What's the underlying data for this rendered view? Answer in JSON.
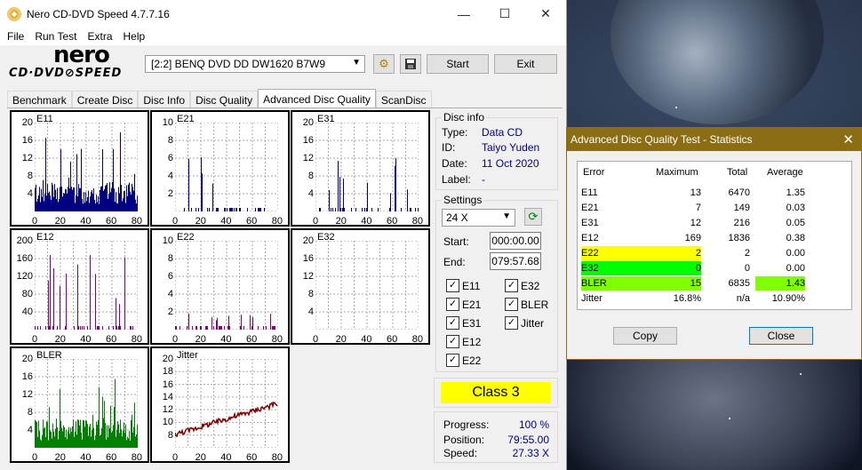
{
  "window": {
    "title": "Nero CD-DVD Speed 4.7.7.16",
    "minimize": "—",
    "maximize": "☐",
    "close": "✕"
  },
  "menu": [
    "File",
    "Run Test",
    "Extra",
    "Help"
  ],
  "logo": {
    "top": "nero",
    "bottom": "CD·DVD⊘SPEED"
  },
  "toolbar": {
    "drive": "[2:2]   BENQ DVD DD DW1620 B7W9",
    "start": "Start",
    "exit": "Exit"
  },
  "tabs": [
    "Benchmark",
    "Create Disc",
    "Disc Info",
    "Disc Quality",
    "Advanced Disc Quality",
    "ScanDisc"
  ],
  "graphs": [
    {
      "name": "E11",
      "yticks": [
        "20",
        "16",
        "12",
        "8",
        "4"
      ],
      "xticks": [
        "0",
        "20",
        "40",
        "60",
        "80"
      ],
      "color": "#000080",
      "peak_percent": 85
    },
    {
      "name": "E21",
      "yticks": [
        "10",
        "8",
        "6",
        "4",
        "2"
      ],
      "xticks": [
        "0",
        "20",
        "40",
        "60",
        "80"
      ],
      "color": "#000080",
      "peak_percent": 70
    },
    {
      "name": "E31",
      "yticks": [
        "20",
        "16",
        "12",
        "8",
        "4"
      ],
      "xticks": [
        "0",
        "20",
        "40",
        "60",
        "80"
      ],
      "color": "#000080",
      "peak_percent": 60
    },
    {
      "name": "E12",
      "yticks": [
        "200",
        "160",
        "120",
        "80",
        "40"
      ],
      "xticks": [
        "0",
        "20",
        "40",
        "60",
        "80"
      ],
      "color": "#800080",
      "peak_percent": 85
    },
    {
      "name": "E22",
      "yticks": [
        "10",
        "8",
        "6",
        "4",
        "2"
      ],
      "xticks": [
        "0",
        "20",
        "40",
        "60",
        "80"
      ],
      "color": "#800080",
      "peak_percent": 20
    },
    {
      "name": "E32",
      "yticks": [
        "20",
        "16",
        "12",
        "8",
        "4"
      ],
      "xticks": [
        "0",
        "20",
        "40",
        "60",
        "80"
      ],
      "color": "#800080",
      "peak_percent": 0
    },
    {
      "name": "BLER",
      "yticks": [
        "20",
        "16",
        "12",
        "8",
        "4"
      ],
      "xticks": [
        "0",
        "20",
        "40",
        "60",
        "80"
      ],
      "color": "#008000",
      "peak_percent": 75
    },
    {
      "name": "Jitter",
      "yticks": [
        "20",
        "18",
        "16",
        "14",
        "12",
        "10",
        "8"
      ],
      "xticks": [
        "0",
        "20",
        "40",
        "60",
        "80"
      ],
      "color": "#800000",
      "peak_percent": 60
    }
  ],
  "disc_info": {
    "title": "Disc info",
    "type_label": "Type:",
    "type": "Data CD",
    "id_label": "ID:",
    "id": "Taiyo Yuden",
    "date_label": "Date:",
    "date": "11 Oct 2020",
    "label_label": "Label:",
    "label": "-"
  },
  "settings": {
    "title": "Settings",
    "speed": "24 X",
    "start_label": "Start:",
    "start": "000:00.00",
    "end_label": "End:",
    "end": "079:57.68",
    "checks_left": [
      "E11",
      "E21",
      "E31",
      "E12",
      "E22"
    ],
    "checks_right": [
      "E32",
      "BLER",
      "Jitter"
    ]
  },
  "class": "Class 3",
  "progress": {
    "progress_label": "Progress:",
    "progress": "100 %",
    "position_label": "Position:",
    "position": "79:55.00",
    "speed_label": "Speed:",
    "speed": "27.33 X"
  },
  "dialog": {
    "title": "Advanced Disc Quality Test - Statistics",
    "headers": [
      "Error",
      "Maximum",
      "Total",
      "Average"
    ],
    "rows": [
      [
        "E11",
        "13",
        "6470",
        "1.35"
      ],
      [
        "E21",
        "7",
        "149",
        "0.03"
      ],
      [
        "E31",
        "12",
        "216",
        "0.05"
      ],
      [
        "E12",
        "169",
        "1836",
        "0.38"
      ],
      [
        "E22",
        "2",
        "2",
        "0.00"
      ],
      [
        "E32",
        "0",
        "0",
        "0.00"
      ],
      [
        "BLER",
        "15",
        "6835",
        "1.43"
      ],
      [
        "Jitter",
        "16.8%",
        "n/a",
        "10.90%"
      ]
    ],
    "highlight_colors": {
      "E22": "#ffff00",
      "E32": "#00ff00",
      "BLER": "#7fff00"
    },
    "copy": "Copy",
    "close": "Close"
  }
}
